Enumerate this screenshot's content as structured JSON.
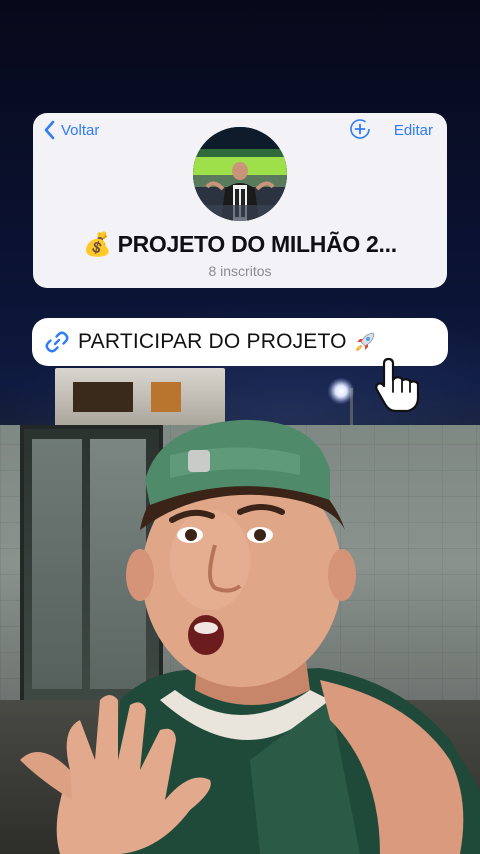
{
  "header": {
    "back_label": "Voltar",
    "edit_label": "Editar",
    "group_name": "💰 PROJETO DO MILHÃO 2...",
    "subscribers": "8 inscritos"
  },
  "join_button": {
    "label": "PARTICIPAR DO PROJETO"
  },
  "icons": {
    "back": "chevron-left-icon",
    "add": "add-circle-icon",
    "link": "link-icon",
    "rocket": "rocket-icon",
    "cursor": "hand-pointer-icon"
  },
  "colors": {
    "accent": "#2f7cf6",
    "card_bg": "#f2f2f7",
    "pill_bg": "#ffffff"
  }
}
